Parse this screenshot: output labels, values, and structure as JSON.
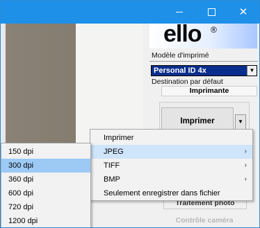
{
  "window": {
    "controls": {
      "minimize_icon": "minimize-icon",
      "maximize_icon": "maximize-icon",
      "close_icon": "close-icon",
      "close_glyph": "✕"
    }
  },
  "panel": {
    "logo": "ello",
    "logo_mark": "®",
    "model_label": "Modèle d'imprimé",
    "model_value": "Personal ID 4x",
    "destination_label": "Destination par défaut",
    "destination_value": "Imprimante",
    "print_button": "Imprimer",
    "dropdown_glyph": "▼",
    "photo_button": "Traitement photo",
    "camera_button": "Contrôle caméra"
  },
  "context_menu": {
    "items": [
      {
        "label": "Imprimer",
        "has_submenu": false
      },
      {
        "label": "JPEG",
        "has_submenu": true
      },
      {
        "label": "TIFF",
        "has_submenu": true
      },
      {
        "label": "BMP",
        "has_submenu": true
      },
      {
        "label": "Seulement enregistrer dans fichier",
        "has_submenu": false
      }
    ],
    "highlighted": "JPEG",
    "submenu_arrow": "›"
  },
  "dpi_submenu": {
    "items": [
      "150 dpi",
      "300 dpi",
      "360 dpi",
      "600 dpi",
      "720 dpi",
      "1200 dpi"
    ],
    "highlighted": "300 dpi"
  },
  "colors": {
    "titlebar": "#1e90e8",
    "menu_highlight": "#cfe5fb",
    "submenu_highlight": "#9ccaf5",
    "model_select": "#0a2e8c"
  }
}
